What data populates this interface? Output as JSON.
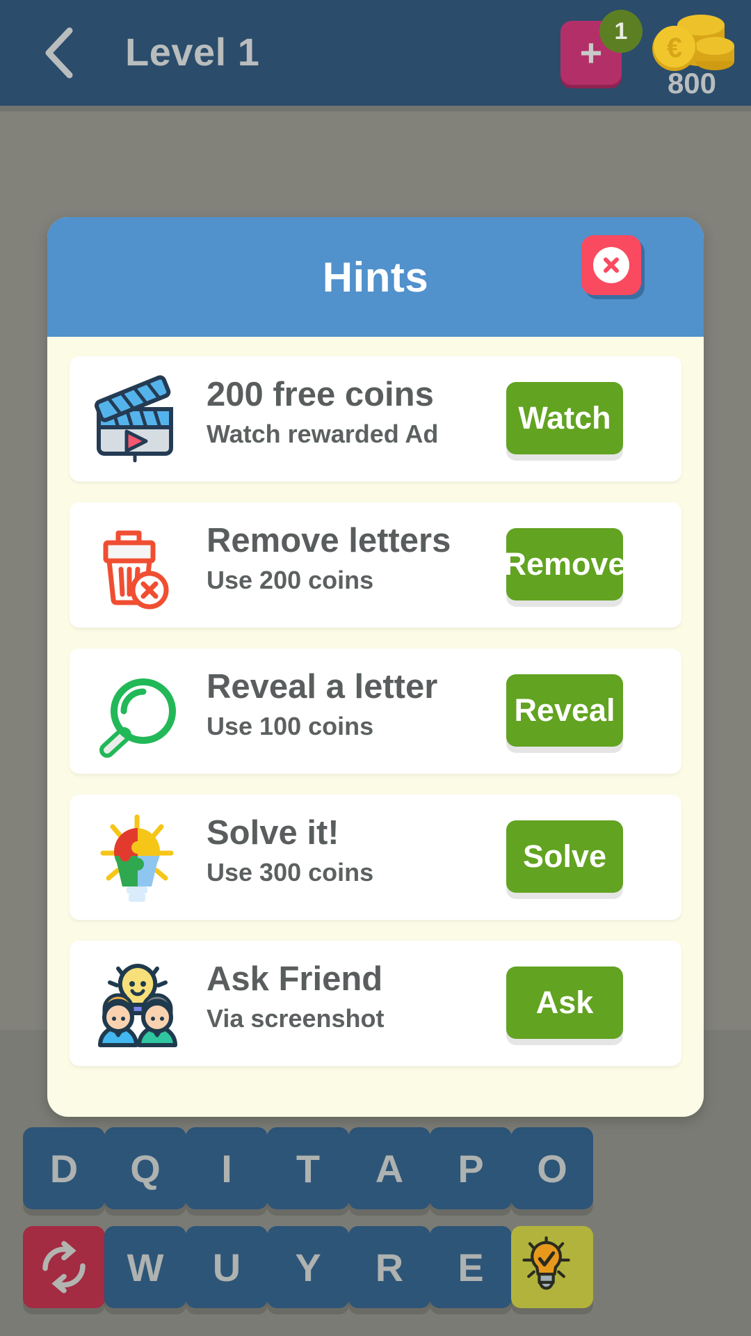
{
  "header": {
    "back_icon": "chevron-left-icon",
    "title": "Level 1",
    "add_icon": "plus-icon",
    "add_badge": "1",
    "coins_icon": "coin-stack-icon",
    "coins": "800",
    "bg_color": "#2b4c6b",
    "title_color": "#b9bdbd",
    "plus_color": "#b32f68",
    "badge_color": "#5d7f23"
  },
  "dialog": {
    "title": "Hints",
    "header_color": "#5191cc",
    "body_color": "#fbfbe6",
    "close_icon": "close-x-icon",
    "close_color": "#fa4a5f",
    "action_color": "#62a321",
    "hints": [
      {
        "icon": "clapperboard-video-icon",
        "title": "200 free coins",
        "subtitle": "Watch rewarded Ad",
        "action": "Watch"
      },
      {
        "icon": "trash-delete-icon",
        "title": "Remove letters",
        "subtitle": "Use 200 coins",
        "action": "Remove"
      },
      {
        "icon": "magnifier-search-icon",
        "title": "Reveal a letter",
        "subtitle": "Use 100 coins",
        "action": "Reveal"
      },
      {
        "icon": "puzzle-lightbulb-icon",
        "title": "Solve it!",
        "subtitle": "Use 300 coins",
        "action": "Solve"
      },
      {
        "icon": "friends-lightbulb-icon",
        "title": "Ask Friend",
        "subtitle": "Via screenshot",
        "action": "Ask"
      }
    ]
  },
  "keyboard": {
    "key_color": "#2d5578",
    "letter_color": "#aeb2b0",
    "shuffle_color": "#a32b42",
    "hint_color": "#b2b33c",
    "row1": [
      {
        "type": "letter",
        "label": "D"
      },
      {
        "type": "letter",
        "label": "Q"
      },
      {
        "type": "letter",
        "label": "I"
      },
      {
        "type": "letter",
        "label": "T"
      },
      {
        "type": "letter",
        "label": "A"
      },
      {
        "type": "letter",
        "label": "P"
      },
      {
        "type": "letter",
        "label": "O"
      }
    ],
    "row2": [
      {
        "type": "shuffle",
        "label": "",
        "icon": "shuffle-refresh-icon"
      },
      {
        "type": "letter",
        "label": "W"
      },
      {
        "type": "letter",
        "label": "U"
      },
      {
        "type": "letter",
        "label": "Y"
      },
      {
        "type": "letter",
        "label": "R"
      },
      {
        "type": "letter",
        "label": "E"
      },
      {
        "type": "hint",
        "label": "",
        "icon": "lightbulb-hint-icon"
      }
    ]
  }
}
